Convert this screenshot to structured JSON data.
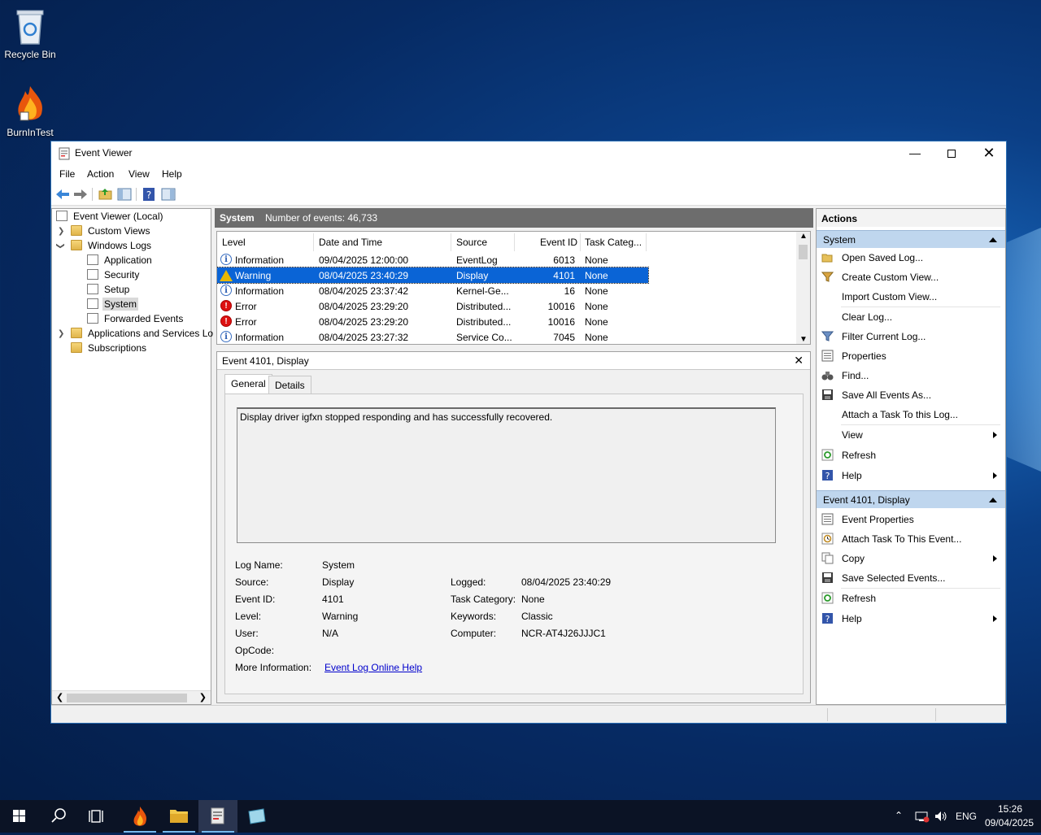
{
  "desktop": {
    "icons": [
      {
        "label": "Recycle Bin"
      },
      {
        "label": "BurnInTest"
      }
    ]
  },
  "window": {
    "title": "Event Viewer",
    "menu": [
      "File",
      "Action",
      "View",
      "Help"
    ]
  },
  "tree": {
    "root": "Event Viewer (Local)",
    "custom_views": "Custom Views",
    "windows_logs": "Windows Logs",
    "application": "Application",
    "security": "Security",
    "setup": "Setup",
    "system": "System",
    "forwarded": "Forwarded Events",
    "app_services": "Applications and Services Lo",
    "subscriptions": "Subscriptions"
  },
  "log": {
    "name": "System",
    "count_text": "Number of events: 46,733",
    "columns": [
      "Level",
      "Date and Time",
      "Source",
      "Event ID",
      "Task Categ..."
    ],
    "rows": [
      {
        "level": "Information",
        "date": "09/04/2025 12:00:00",
        "source": "EventLog",
        "id": "6013",
        "task": "None",
        "type": "info"
      },
      {
        "level": "Warning",
        "date": "08/04/2025 23:40:29",
        "source": "Display",
        "id": "4101",
        "task": "None",
        "type": "warn"
      },
      {
        "level": "Information",
        "date": "08/04/2025 23:37:42",
        "source": "Kernel-Ge...",
        "id": "16",
        "task": "None",
        "type": "info"
      },
      {
        "level": "Error",
        "date": "08/04/2025 23:29:20",
        "source": "Distributed...",
        "id": "10016",
        "task": "None",
        "type": "err"
      },
      {
        "level": "Error",
        "date": "08/04/2025 23:29:20",
        "source": "Distributed...",
        "id": "10016",
        "task": "None",
        "type": "err"
      },
      {
        "level": "Information",
        "date": "08/04/2025 23:27:32",
        "source": "Service Co...",
        "id": "7045",
        "task": "None",
        "type": "info"
      }
    ]
  },
  "detail": {
    "title": "Event 4101, Display",
    "tabs": [
      "General",
      "Details"
    ],
    "message": "Display driver igfxn stopped responding and has successfully recovered.",
    "labels": {
      "log_name": "Log Name:",
      "source": "Source:",
      "event_id": "Event ID:",
      "level": "Level:",
      "user": "User:",
      "opcode": "OpCode:",
      "more_info": "More Information:",
      "logged": "Logged:",
      "task_category": "Task Category:",
      "keywords": "Keywords:",
      "computer": "Computer:"
    },
    "values": {
      "log_name": "System",
      "source": "Display",
      "event_id": "4101",
      "level": "Warning",
      "user": "N/A",
      "opcode": "",
      "more_info": "Event Log Online Help",
      "logged": "08/04/2025 23:40:29",
      "task_category": "None",
      "keywords": "Classic",
      "computer": "NCR-AT4J26JJJC1"
    }
  },
  "actions": {
    "title": "Actions",
    "section1": "System",
    "items1": [
      "Open Saved Log...",
      "Create Custom View...",
      "Import Custom View...",
      "Clear Log...",
      "Filter Current Log...",
      "Properties",
      "Find...",
      "Save All Events As...",
      "Attach a Task To this Log...",
      "View",
      "Refresh",
      "Help"
    ],
    "section2": "Event 4101, Display",
    "items2": [
      "Event Properties",
      "Attach Task To This Event...",
      "Copy",
      "Save Selected Events...",
      "Refresh",
      "Help"
    ]
  },
  "taskbar": {
    "lang": "ENG",
    "time": "15:26",
    "date": "09/04/2025"
  }
}
